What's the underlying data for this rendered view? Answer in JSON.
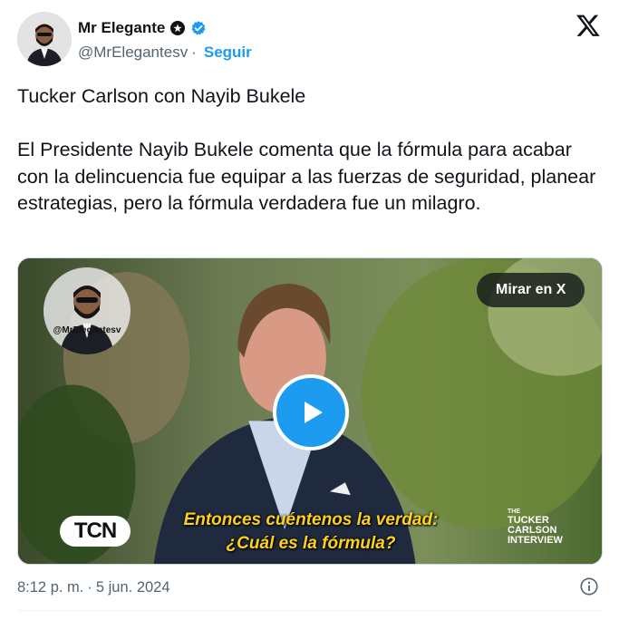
{
  "author": {
    "display_name": "Mr Elegante",
    "handle": "@MrElegantesv",
    "separator": "·",
    "follow_label": "Seguir",
    "avatar_icon": "profile-avatar"
  },
  "platform_icon": "x-logo-icon",
  "tweet": {
    "text": "Tucker Carlson con Nayib Bukele\n\nEl Presidente Nayib Bukele comenta que la fórmula para acabar con la delincuencia fue equipar a las fuerzas de seguridad, planear estrategias, pero la fórmula verdadera fue un milagro."
  },
  "media": {
    "watch_label": "Mirar en X",
    "watermark": "@MrElegantesv",
    "subtitle_line1": "Entonces cuéntenos la verdad:",
    "subtitle_line2": "¿Cuál es la fórmula?",
    "tcn_logo": "TCN",
    "show_logo_small": "THE",
    "show_logo_line1": "TUCKER",
    "show_logo_line2": "CARLSON",
    "show_logo_line3": "INTERVIEW"
  },
  "meta": {
    "time": "8:12 p. m.",
    "separator": "·",
    "date": "5 jun. 2024"
  },
  "colors": {
    "accent": "#1d9bf0",
    "text": "#0f1419",
    "secondary": "#536471",
    "subtitle": "#ffd21a"
  }
}
